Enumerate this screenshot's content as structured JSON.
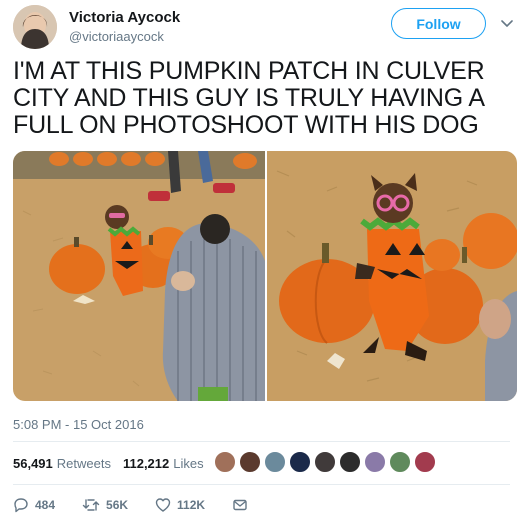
{
  "author": {
    "name": "Victoria Aycock",
    "handle": "@victoriaaycock",
    "avatar_icon": "profile-photo"
  },
  "header": {
    "follow_label": "Follow",
    "caret_icon": "chevron-down-icon"
  },
  "tweet": {
    "text": "I'M AT THIS PUMPKIN PATCH IN CULVER CITY AND THIS GUY IS TRULY HAVING A FULL ON PHOTOSHOOT WITH HIS DOG",
    "timestamp": "5:08 PM - 15 Oct 2016"
  },
  "stats": {
    "retweets_count": "56,491",
    "retweets_label": "Retweets",
    "likes_count": "112,212",
    "likes_label": "Likes"
  },
  "liker_colors": [
    "#a0705a",
    "#5b3a2e",
    "#6b8a9c",
    "#1b2a4a",
    "#403a3a",
    "#2c2c2c",
    "#8a7aa8",
    "#5f8a5c",
    "#a23b4e"
  ],
  "actions": {
    "reply_count": "484",
    "retweet_count": "56K",
    "like_count": "112K"
  },
  "colors": {
    "accent": "#1da1f2",
    "text_secondary": "#657786",
    "pumpkin": "#e8731f",
    "hay": "#c9a064"
  }
}
